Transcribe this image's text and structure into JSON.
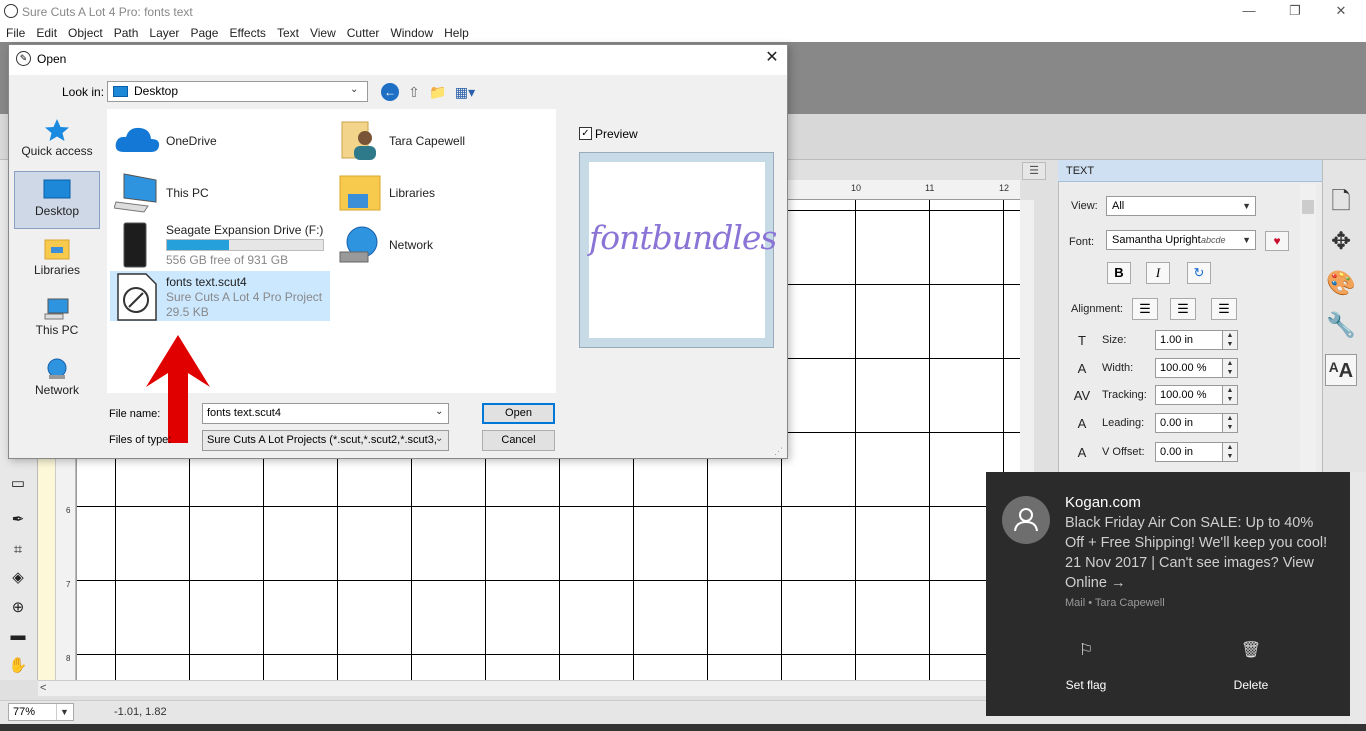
{
  "app": {
    "title": "Sure Cuts A Lot 4 Pro: fonts text",
    "window_buttons": {
      "minimize": "—",
      "restore": "❐",
      "close": "✕"
    }
  },
  "menu": [
    "File",
    "Edit",
    "Object",
    "Path",
    "Layer",
    "Page",
    "Effects",
    "Text",
    "View",
    "Cutter",
    "Window",
    "Help"
  ],
  "ruler": {
    "h_numbers": [
      "10",
      "11",
      "12"
    ],
    "v_numbers": [
      "6",
      "7",
      "8"
    ]
  },
  "status": {
    "zoom": "77%",
    "coords": "-1.01, 1.82"
  },
  "text_panel": {
    "header": "TEXT",
    "view_label": "View:",
    "view_value": "All",
    "font_label": "Font:",
    "font_value": "Samantha Upright",
    "font_sample": "abcde",
    "style_buttons": {
      "bold": "B",
      "italic": "I",
      "reset": "↻"
    },
    "alignment_label": "Alignment:",
    "fields": [
      {
        "label": "Size:",
        "value": "1.00 in"
      },
      {
        "label": "Width:",
        "value": "100.00 %"
      },
      {
        "label": "Tracking:",
        "value": "100.00 %"
      },
      {
        "label": "Leading:",
        "value": "0.00 in"
      },
      {
        "label": "V Offset:",
        "value": "0.00 in"
      }
    ]
  },
  "dialog": {
    "title": "Open",
    "lookin_label": "Look in:",
    "lookin_value": "Desktop",
    "places": [
      {
        "label": "Quick access",
        "icon": "star-icon"
      },
      {
        "label": "Desktop",
        "icon": "desktop-icon",
        "selected": true
      },
      {
        "label": "Libraries",
        "icon": "libraries-folder-icon"
      },
      {
        "label": "This PC",
        "icon": "computer-icon"
      },
      {
        "label": "Network",
        "icon": "network-globe-icon"
      }
    ],
    "files": {
      "onedrive": "OneDrive",
      "user": "Tara Capewell",
      "thispc": "This PC",
      "libraries": "Libraries",
      "drive_name": "Seagate Expansion Drive (F:)",
      "drive_free": "556 GB free of 931 GB",
      "drive_used_fraction": 0.4,
      "network": "Network",
      "file_name": "fonts text.scut4",
      "file_type": "Sure Cuts A Lot 4 Pro Project",
      "file_size": "29.5 KB"
    },
    "preview_label": "Preview",
    "preview_text": "fontbundles",
    "filename_label": "File name:",
    "filename_value": "fonts text.scut4",
    "filetype_label": "Files of type:",
    "filetype_value": "Sure Cuts A Lot Projects (*.scut,*.scut2,*.scut3,",
    "open_button": "Open",
    "cancel_button": "Cancel"
  },
  "notification": {
    "sender": "Kogan.com",
    "body": "Black Friday Air Con SALE: Up to 40% Off + Free Shipping! We'll keep you cool!    21 Nov 2017 | Can't see images? View Online →",
    "attribution": "Mail • Tara Capewell",
    "actions": {
      "flag": "Set flag",
      "delete": "Delete"
    }
  },
  "colors": {
    "accent": "#0078d7",
    "selection": "#cce8ff",
    "toast_bg": "#2b2b2b",
    "arrow": "#e00000",
    "preview_text": "#8a74d6"
  }
}
